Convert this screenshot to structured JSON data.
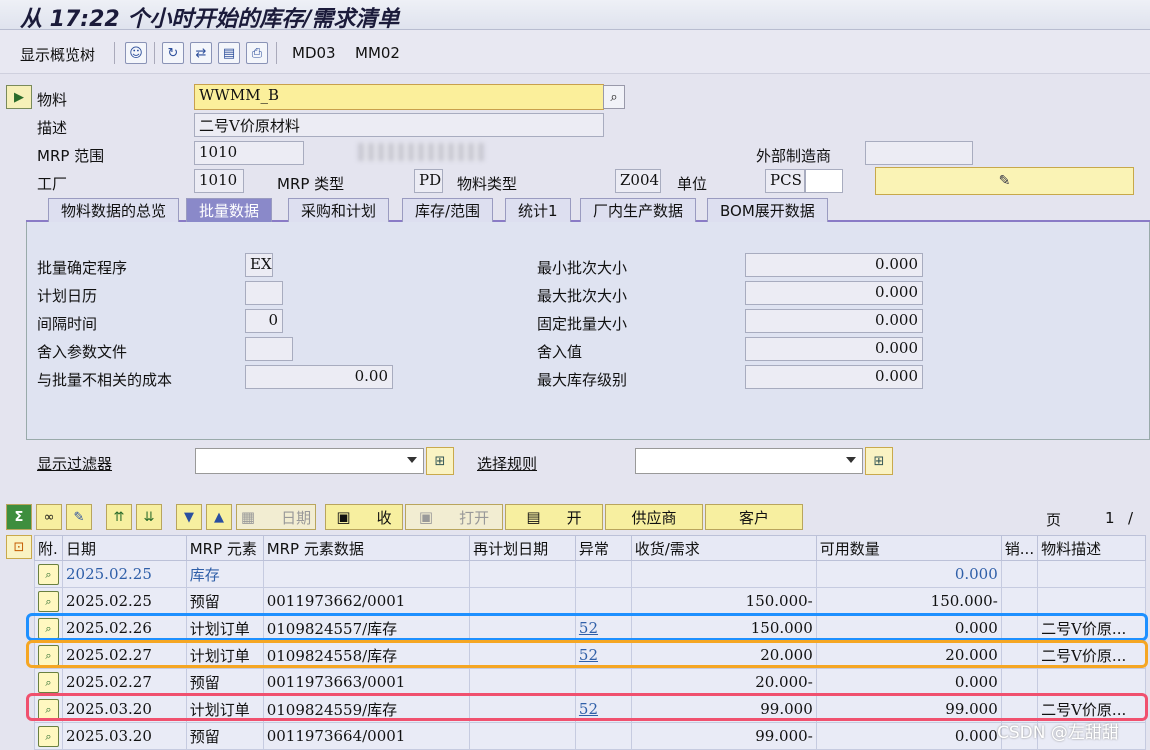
{
  "window": {
    "title": "从 17:22 个小时开始的库存/需求清单"
  },
  "toolbar": {
    "show_tree": "显示概览树",
    "md03": "MD03",
    "mm02": "MM02",
    "icons": [
      "people-icon",
      "refresh-icon",
      "transfer-icon",
      "documents-icon",
      "print-icon"
    ]
  },
  "header": {
    "material_label": "物料",
    "material_value": "WWMM_B",
    "desc_label": "描述",
    "desc_value": "二号V价原材料",
    "mrp_area_label": "MRP 范围",
    "mrp_area_value": "1010",
    "ext_mfr_label": "外部制造商",
    "ext_mfr_value": "",
    "plant_label": "工厂",
    "plant_value": "1010",
    "mrp_type_label": "MRP 类型",
    "mrp_type_value": "PD",
    "mat_type_label": "物料类型",
    "mat_type_value": "Z004",
    "unit_label": "单位",
    "unit_value": "PCS"
  },
  "tabs": [
    {
      "label": "物料数据的总览",
      "active": false
    },
    {
      "label": "批量数据",
      "active": true
    },
    {
      "label": "采购和计划",
      "active": false
    },
    {
      "label": "库存/范围",
      "active": false
    },
    {
      "label": "统计1",
      "active": false
    },
    {
      "label": "厂内生产数据",
      "active": false
    },
    {
      "label": "BOM展开数据",
      "active": false
    }
  ],
  "lot": {
    "procedure_label": "批量确定程序",
    "procedure_value": "EX",
    "calendar_label": "计划日历",
    "calendar_value": "",
    "interval_label": "间隔时间",
    "interval_value": "0",
    "rounding_profile_label": "舍入参数文件",
    "rounding_profile_value": "",
    "lot_indep_cost_label": "与批量不相关的成本",
    "lot_indep_cost_value": "0.00",
    "min_lot_label": "最小批次大小",
    "min_lot_value": "0.000",
    "max_lot_label": "最大批次大小",
    "max_lot_value": "0.000",
    "fixed_lot_label": "固定批量大小",
    "fixed_lot_value": "0.000",
    "rounding_value_label": "舍入值",
    "rounding_value_value": "0.000",
    "max_stock_label": "最大库存级别",
    "max_stock_value": "0.000"
  },
  "filters": {
    "display_filter_label": "显示过滤器",
    "selection_rule_label": "选择规则"
  },
  "grid_toolbar": {
    "date_label": "日期",
    "receipt_label": "收",
    "open_label": "打开",
    "open2_label": "开",
    "vendor_label": "供应商",
    "customer_label": "客户",
    "page_label": "页",
    "page_value": "1",
    "page_sep": "/"
  },
  "grid": {
    "columns": [
      "附.",
      "日期",
      "MRP 元素",
      "MRP 元素数据",
      "再计划日期",
      "异常",
      "收货/需求",
      "可用数量",
      "销...",
      "物料描述"
    ],
    "rows": [
      {
        "date": "2025.02.25",
        "element": "库存",
        "data": "",
        "resched": "",
        "exception": "",
        "qty": "",
        "avail": "0.000",
        "desc": "",
        "blue": true
      },
      {
        "date": "2025.02.25",
        "element": "预留",
        "data": "0011973662/0001",
        "resched": "",
        "exception": "",
        "qty": "150.000-",
        "avail": "150.000-",
        "desc": "",
        "blue": false
      },
      {
        "date": "2025.02.26",
        "element": "计划订单",
        "data": "0109824557/库存",
        "resched": "",
        "exception": "52",
        "qty": "150.000",
        "avail": "0.000",
        "desc": "二号V价原...",
        "blue": false
      },
      {
        "date": "2025.02.27",
        "element": "计划订单",
        "data": "0109824558/库存",
        "resched": "",
        "exception": "52",
        "qty": "20.000",
        "avail": "20.000",
        "desc": "二号V价原...",
        "blue": false
      },
      {
        "date": "2025.02.27",
        "element": "预留",
        "data": "0011973663/0001",
        "resched": "",
        "exception": "",
        "qty": "20.000-",
        "avail": "0.000",
        "desc": "",
        "blue": false
      },
      {
        "date": "2025.03.20",
        "element": "计划订单",
        "data": "0109824559/库存",
        "resched": "",
        "exception": "52",
        "qty": "99.000",
        "avail": "99.000",
        "desc": "二号V价原...",
        "blue": false
      },
      {
        "date": "2025.03.20",
        "element": "预留",
        "data": "0011973664/0001",
        "resched": "",
        "exception": "",
        "qty": "99.000-",
        "avail": "0.000",
        "desc": "",
        "blue": false
      }
    ]
  },
  "highlights": {
    "blue": "#1e90ff",
    "orange": "#f5a623",
    "red": "#f0506e"
  },
  "watermark": "CSDN @左甜甜"
}
